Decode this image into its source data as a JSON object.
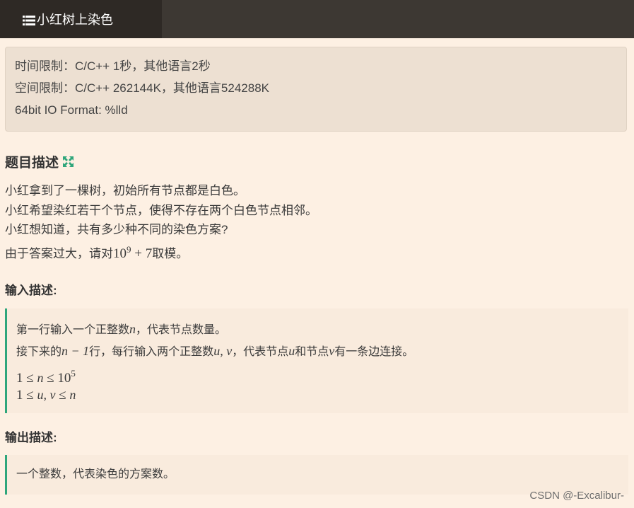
{
  "header": {
    "tab_title": "小红树上染色",
    "tab_icon": "list-icon"
  },
  "limits": {
    "time": "时间限制：C/C++ 1秒，其他语言2秒",
    "space": "空间限制：C/C++ 262144K，其他语言524288K",
    "io_format": "64bit IO Format: %lld"
  },
  "problem": {
    "title": "题目描述",
    "expand_icon": "expand-icon",
    "line1": "小红拿到了一棵树，初始所有节点都是白色。",
    "line2": "小红希望染红若干个节点，使得不存在两个白色节点相邻。",
    "line3": "小红想知道，共有多少种不同的染色方案?",
    "line4_prefix": "由于答案过大，请对",
    "line4_math_base": "10",
    "line4_math_exp": "9",
    "line4_math_rest": " + 7",
    "line4_suffix": "取模。"
  },
  "input": {
    "title": "输入描述:",
    "l1_a": "第一行输入一个正整数",
    "l1_var": "n",
    "l1_b": "，代表节点数量。",
    "l2_a": "接下来的",
    "l2_expr": "n − 1",
    "l2_b": "行，每行输入两个正整数",
    "l2_vars": "u, v",
    "l2_c": "，代表节点",
    "l2_u": "u",
    "l2_d": "和节点",
    "l2_v": "v",
    "l2_e": "有一条边连接。",
    "l3_a": "1 ≤ ",
    "l3_var": "n",
    "l3_b": " ≤ 10",
    "l3_exp": "5",
    "l4_a": "1 ≤ ",
    "l4_vars": "u, v",
    "l4_b": " ≤ ",
    "l4_var": "n"
  },
  "output": {
    "title": "输出描述:",
    "text": "一个整数，代表染色的方案数。"
  },
  "watermark": "CSDN @-Excalibur-",
  "colors": {
    "background": "#fdf0e3",
    "topbar": "#3d3833",
    "accent": "#2fa67b"
  }
}
